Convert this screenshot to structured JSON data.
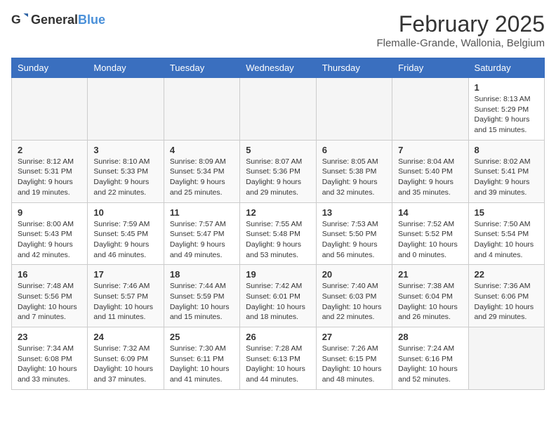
{
  "logo": {
    "general": "General",
    "blue": "Blue"
  },
  "title": "February 2025",
  "subtitle": "Flemalle-Grande, Wallonia, Belgium",
  "weekdays": [
    "Sunday",
    "Monday",
    "Tuesday",
    "Wednesday",
    "Thursday",
    "Friday",
    "Saturday"
  ],
  "weeks": [
    [
      {
        "day": "",
        "info": ""
      },
      {
        "day": "",
        "info": ""
      },
      {
        "day": "",
        "info": ""
      },
      {
        "day": "",
        "info": ""
      },
      {
        "day": "",
        "info": ""
      },
      {
        "day": "",
        "info": ""
      },
      {
        "day": "1",
        "info": "Sunrise: 8:13 AM\nSunset: 5:29 PM\nDaylight: 9 hours and 15 minutes."
      }
    ],
    [
      {
        "day": "2",
        "info": "Sunrise: 8:12 AM\nSunset: 5:31 PM\nDaylight: 9 hours and 19 minutes."
      },
      {
        "day": "3",
        "info": "Sunrise: 8:10 AM\nSunset: 5:33 PM\nDaylight: 9 hours and 22 minutes."
      },
      {
        "day": "4",
        "info": "Sunrise: 8:09 AM\nSunset: 5:34 PM\nDaylight: 9 hours and 25 minutes."
      },
      {
        "day": "5",
        "info": "Sunrise: 8:07 AM\nSunset: 5:36 PM\nDaylight: 9 hours and 29 minutes."
      },
      {
        "day": "6",
        "info": "Sunrise: 8:05 AM\nSunset: 5:38 PM\nDaylight: 9 hours and 32 minutes."
      },
      {
        "day": "7",
        "info": "Sunrise: 8:04 AM\nSunset: 5:40 PM\nDaylight: 9 hours and 35 minutes."
      },
      {
        "day": "8",
        "info": "Sunrise: 8:02 AM\nSunset: 5:41 PM\nDaylight: 9 hours and 39 minutes."
      }
    ],
    [
      {
        "day": "9",
        "info": "Sunrise: 8:00 AM\nSunset: 5:43 PM\nDaylight: 9 hours and 42 minutes."
      },
      {
        "day": "10",
        "info": "Sunrise: 7:59 AM\nSunset: 5:45 PM\nDaylight: 9 hours and 46 minutes."
      },
      {
        "day": "11",
        "info": "Sunrise: 7:57 AM\nSunset: 5:47 PM\nDaylight: 9 hours and 49 minutes."
      },
      {
        "day": "12",
        "info": "Sunrise: 7:55 AM\nSunset: 5:48 PM\nDaylight: 9 hours and 53 minutes."
      },
      {
        "day": "13",
        "info": "Sunrise: 7:53 AM\nSunset: 5:50 PM\nDaylight: 9 hours and 56 minutes."
      },
      {
        "day": "14",
        "info": "Sunrise: 7:52 AM\nSunset: 5:52 PM\nDaylight: 10 hours and 0 minutes."
      },
      {
        "day": "15",
        "info": "Sunrise: 7:50 AM\nSunset: 5:54 PM\nDaylight: 10 hours and 4 minutes."
      }
    ],
    [
      {
        "day": "16",
        "info": "Sunrise: 7:48 AM\nSunset: 5:56 PM\nDaylight: 10 hours and 7 minutes."
      },
      {
        "day": "17",
        "info": "Sunrise: 7:46 AM\nSunset: 5:57 PM\nDaylight: 10 hours and 11 minutes."
      },
      {
        "day": "18",
        "info": "Sunrise: 7:44 AM\nSunset: 5:59 PM\nDaylight: 10 hours and 15 minutes."
      },
      {
        "day": "19",
        "info": "Sunrise: 7:42 AM\nSunset: 6:01 PM\nDaylight: 10 hours and 18 minutes."
      },
      {
        "day": "20",
        "info": "Sunrise: 7:40 AM\nSunset: 6:03 PM\nDaylight: 10 hours and 22 minutes."
      },
      {
        "day": "21",
        "info": "Sunrise: 7:38 AM\nSunset: 6:04 PM\nDaylight: 10 hours and 26 minutes."
      },
      {
        "day": "22",
        "info": "Sunrise: 7:36 AM\nSunset: 6:06 PM\nDaylight: 10 hours and 29 minutes."
      }
    ],
    [
      {
        "day": "23",
        "info": "Sunrise: 7:34 AM\nSunset: 6:08 PM\nDaylight: 10 hours and 33 minutes."
      },
      {
        "day": "24",
        "info": "Sunrise: 7:32 AM\nSunset: 6:09 PM\nDaylight: 10 hours and 37 minutes."
      },
      {
        "day": "25",
        "info": "Sunrise: 7:30 AM\nSunset: 6:11 PM\nDaylight: 10 hours and 41 minutes."
      },
      {
        "day": "26",
        "info": "Sunrise: 7:28 AM\nSunset: 6:13 PM\nDaylight: 10 hours and 44 minutes."
      },
      {
        "day": "27",
        "info": "Sunrise: 7:26 AM\nSunset: 6:15 PM\nDaylight: 10 hours and 48 minutes."
      },
      {
        "day": "28",
        "info": "Sunrise: 7:24 AM\nSunset: 6:16 PM\nDaylight: 10 hours and 52 minutes."
      },
      {
        "day": "",
        "info": ""
      }
    ]
  ]
}
